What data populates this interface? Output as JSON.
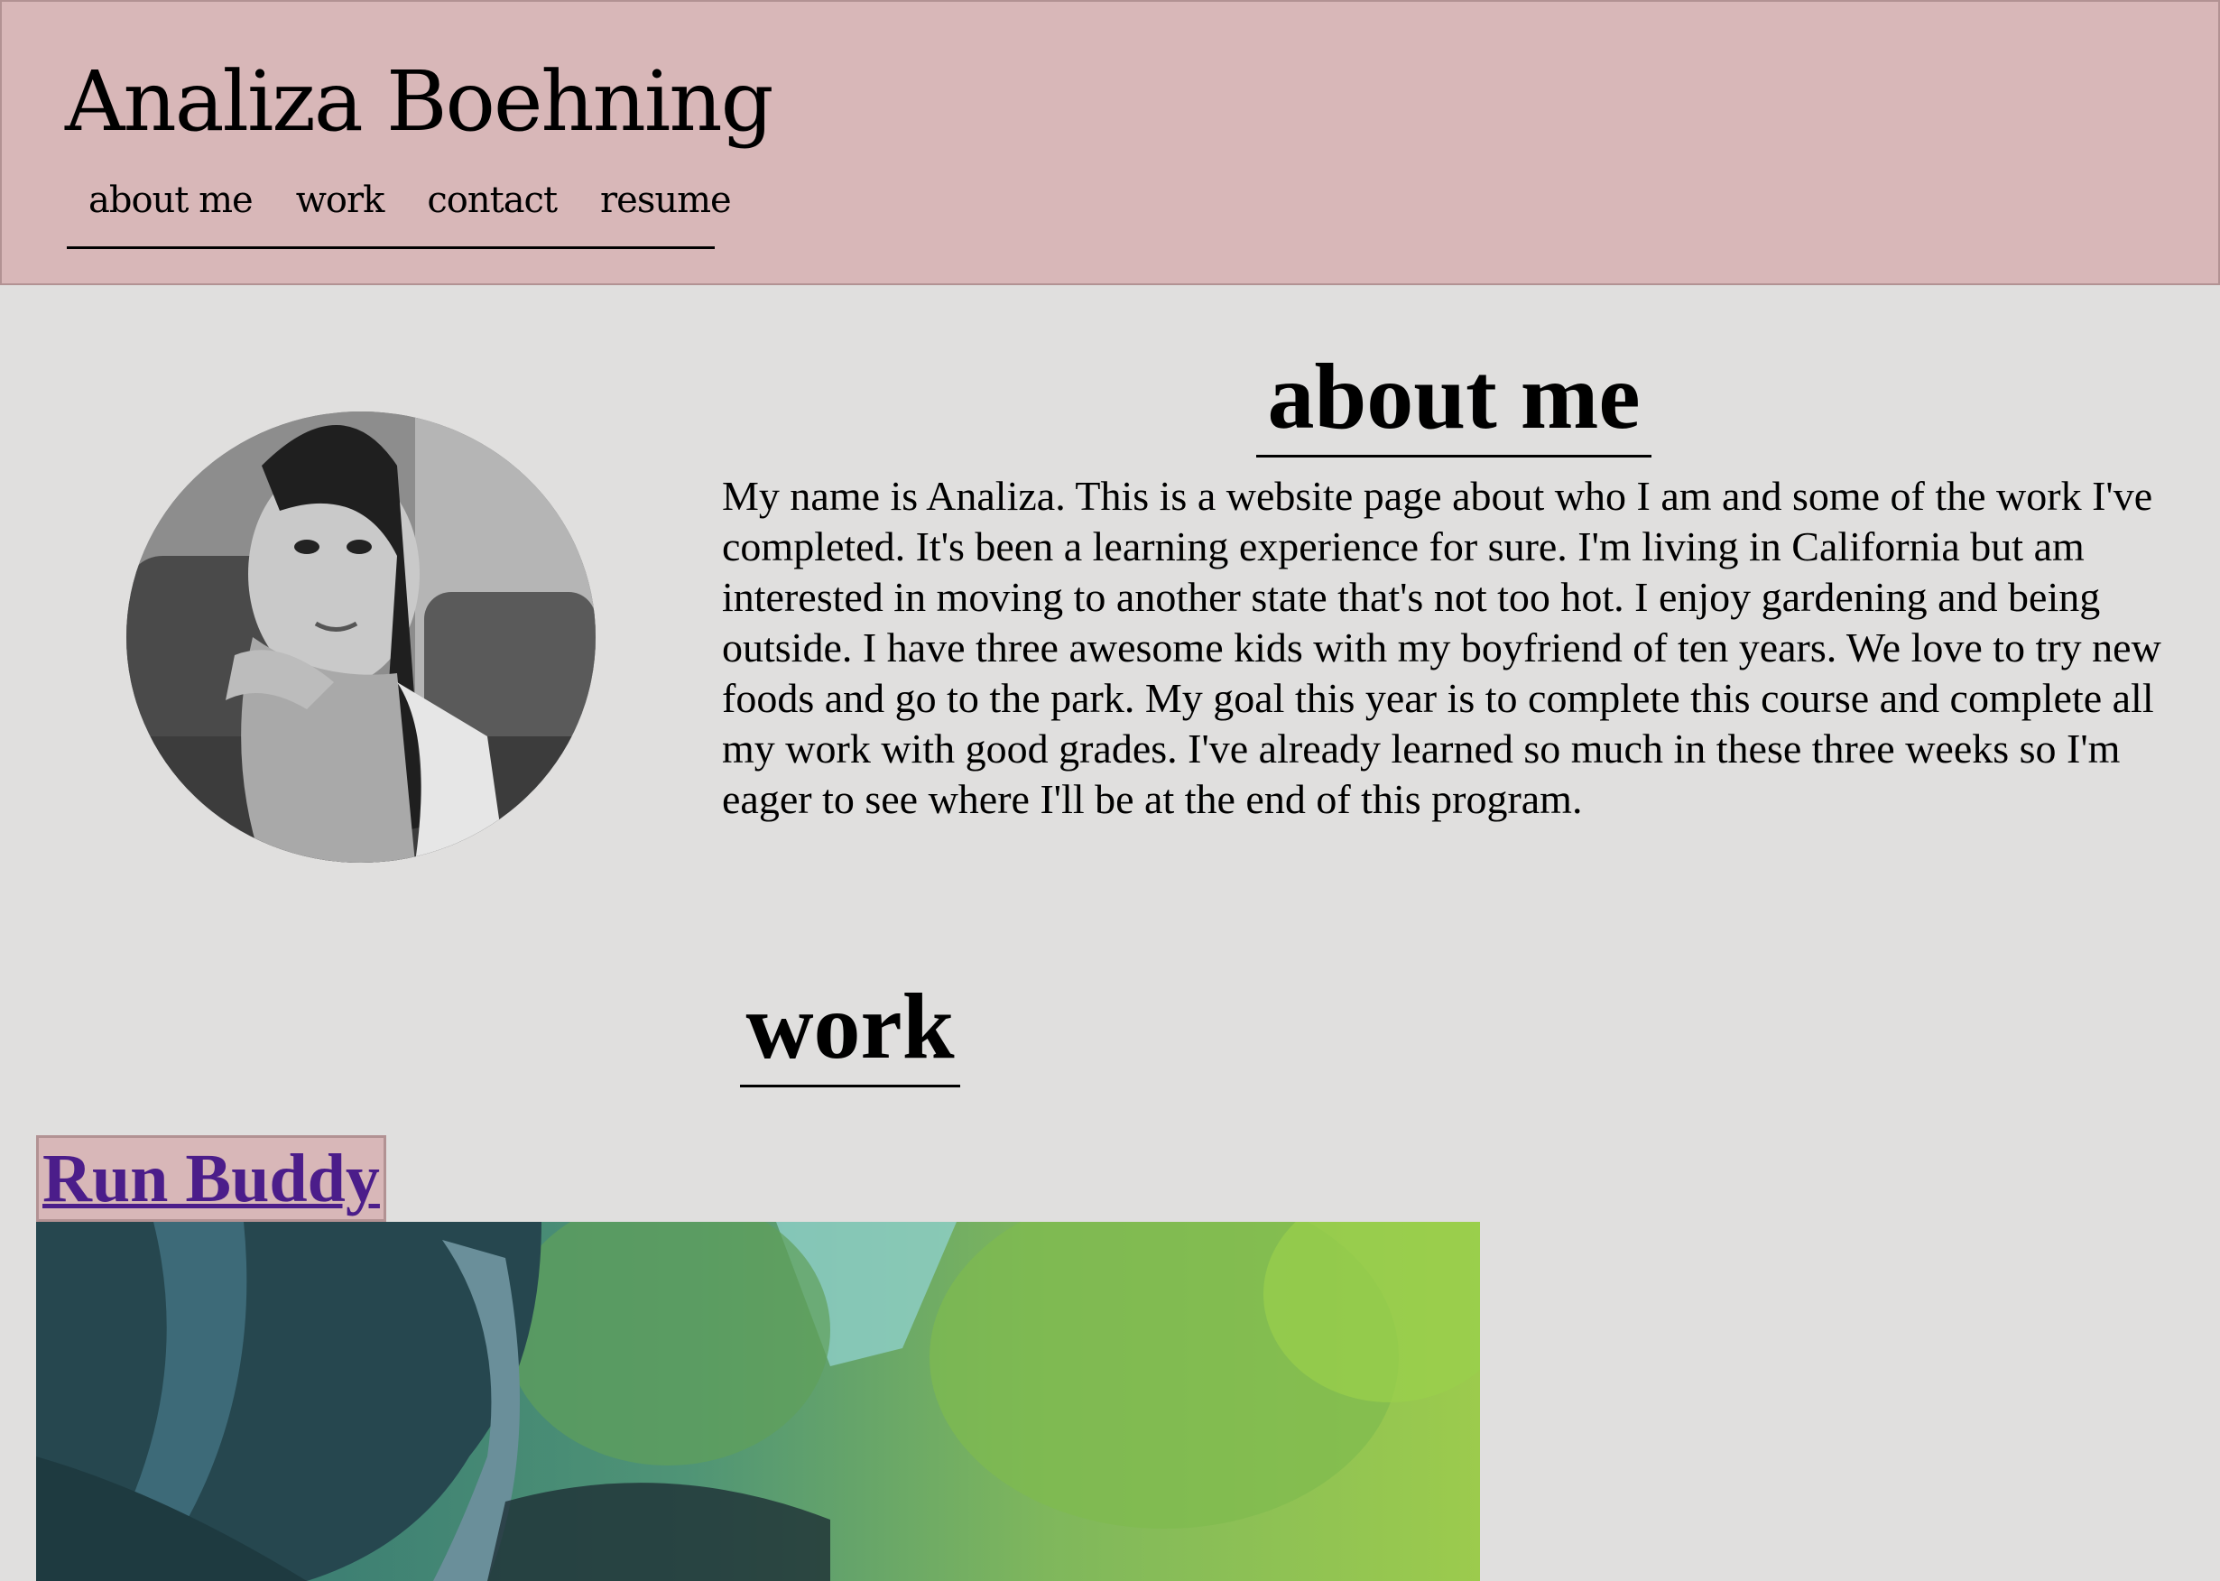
{
  "header": {
    "title": "Analiza Boehning",
    "nav": [
      {
        "label": "about me"
      },
      {
        "label": "work"
      },
      {
        "label": "contact"
      },
      {
        "label": "resume"
      }
    ]
  },
  "about": {
    "heading": "about me",
    "photo_alt": "portrait photo",
    "text": "My name is Analiza. This is a website page about who I am and some of the work I've completed. It's been a learning experience for sure. I'm living in California but am interested in moving to another state that's not too hot. I enjoy gardening and being outside. I have three awesome kids with my boyfriend of ten years. We love to try new foods and go to the park. My goal this year is to complete this course and complete all my work with good grades. I've already learned so much in these three weeks so I'm eager to see where I'll be at the end of this program."
  },
  "work": {
    "heading": "work",
    "projects": [
      {
        "title": "Run Buddy",
        "image": "runner-photo"
      }
    ]
  },
  "colors": {
    "header_bg": "#d8b7b8",
    "page_bg": "#e0dfde",
    "link": "#4b1d8a"
  }
}
